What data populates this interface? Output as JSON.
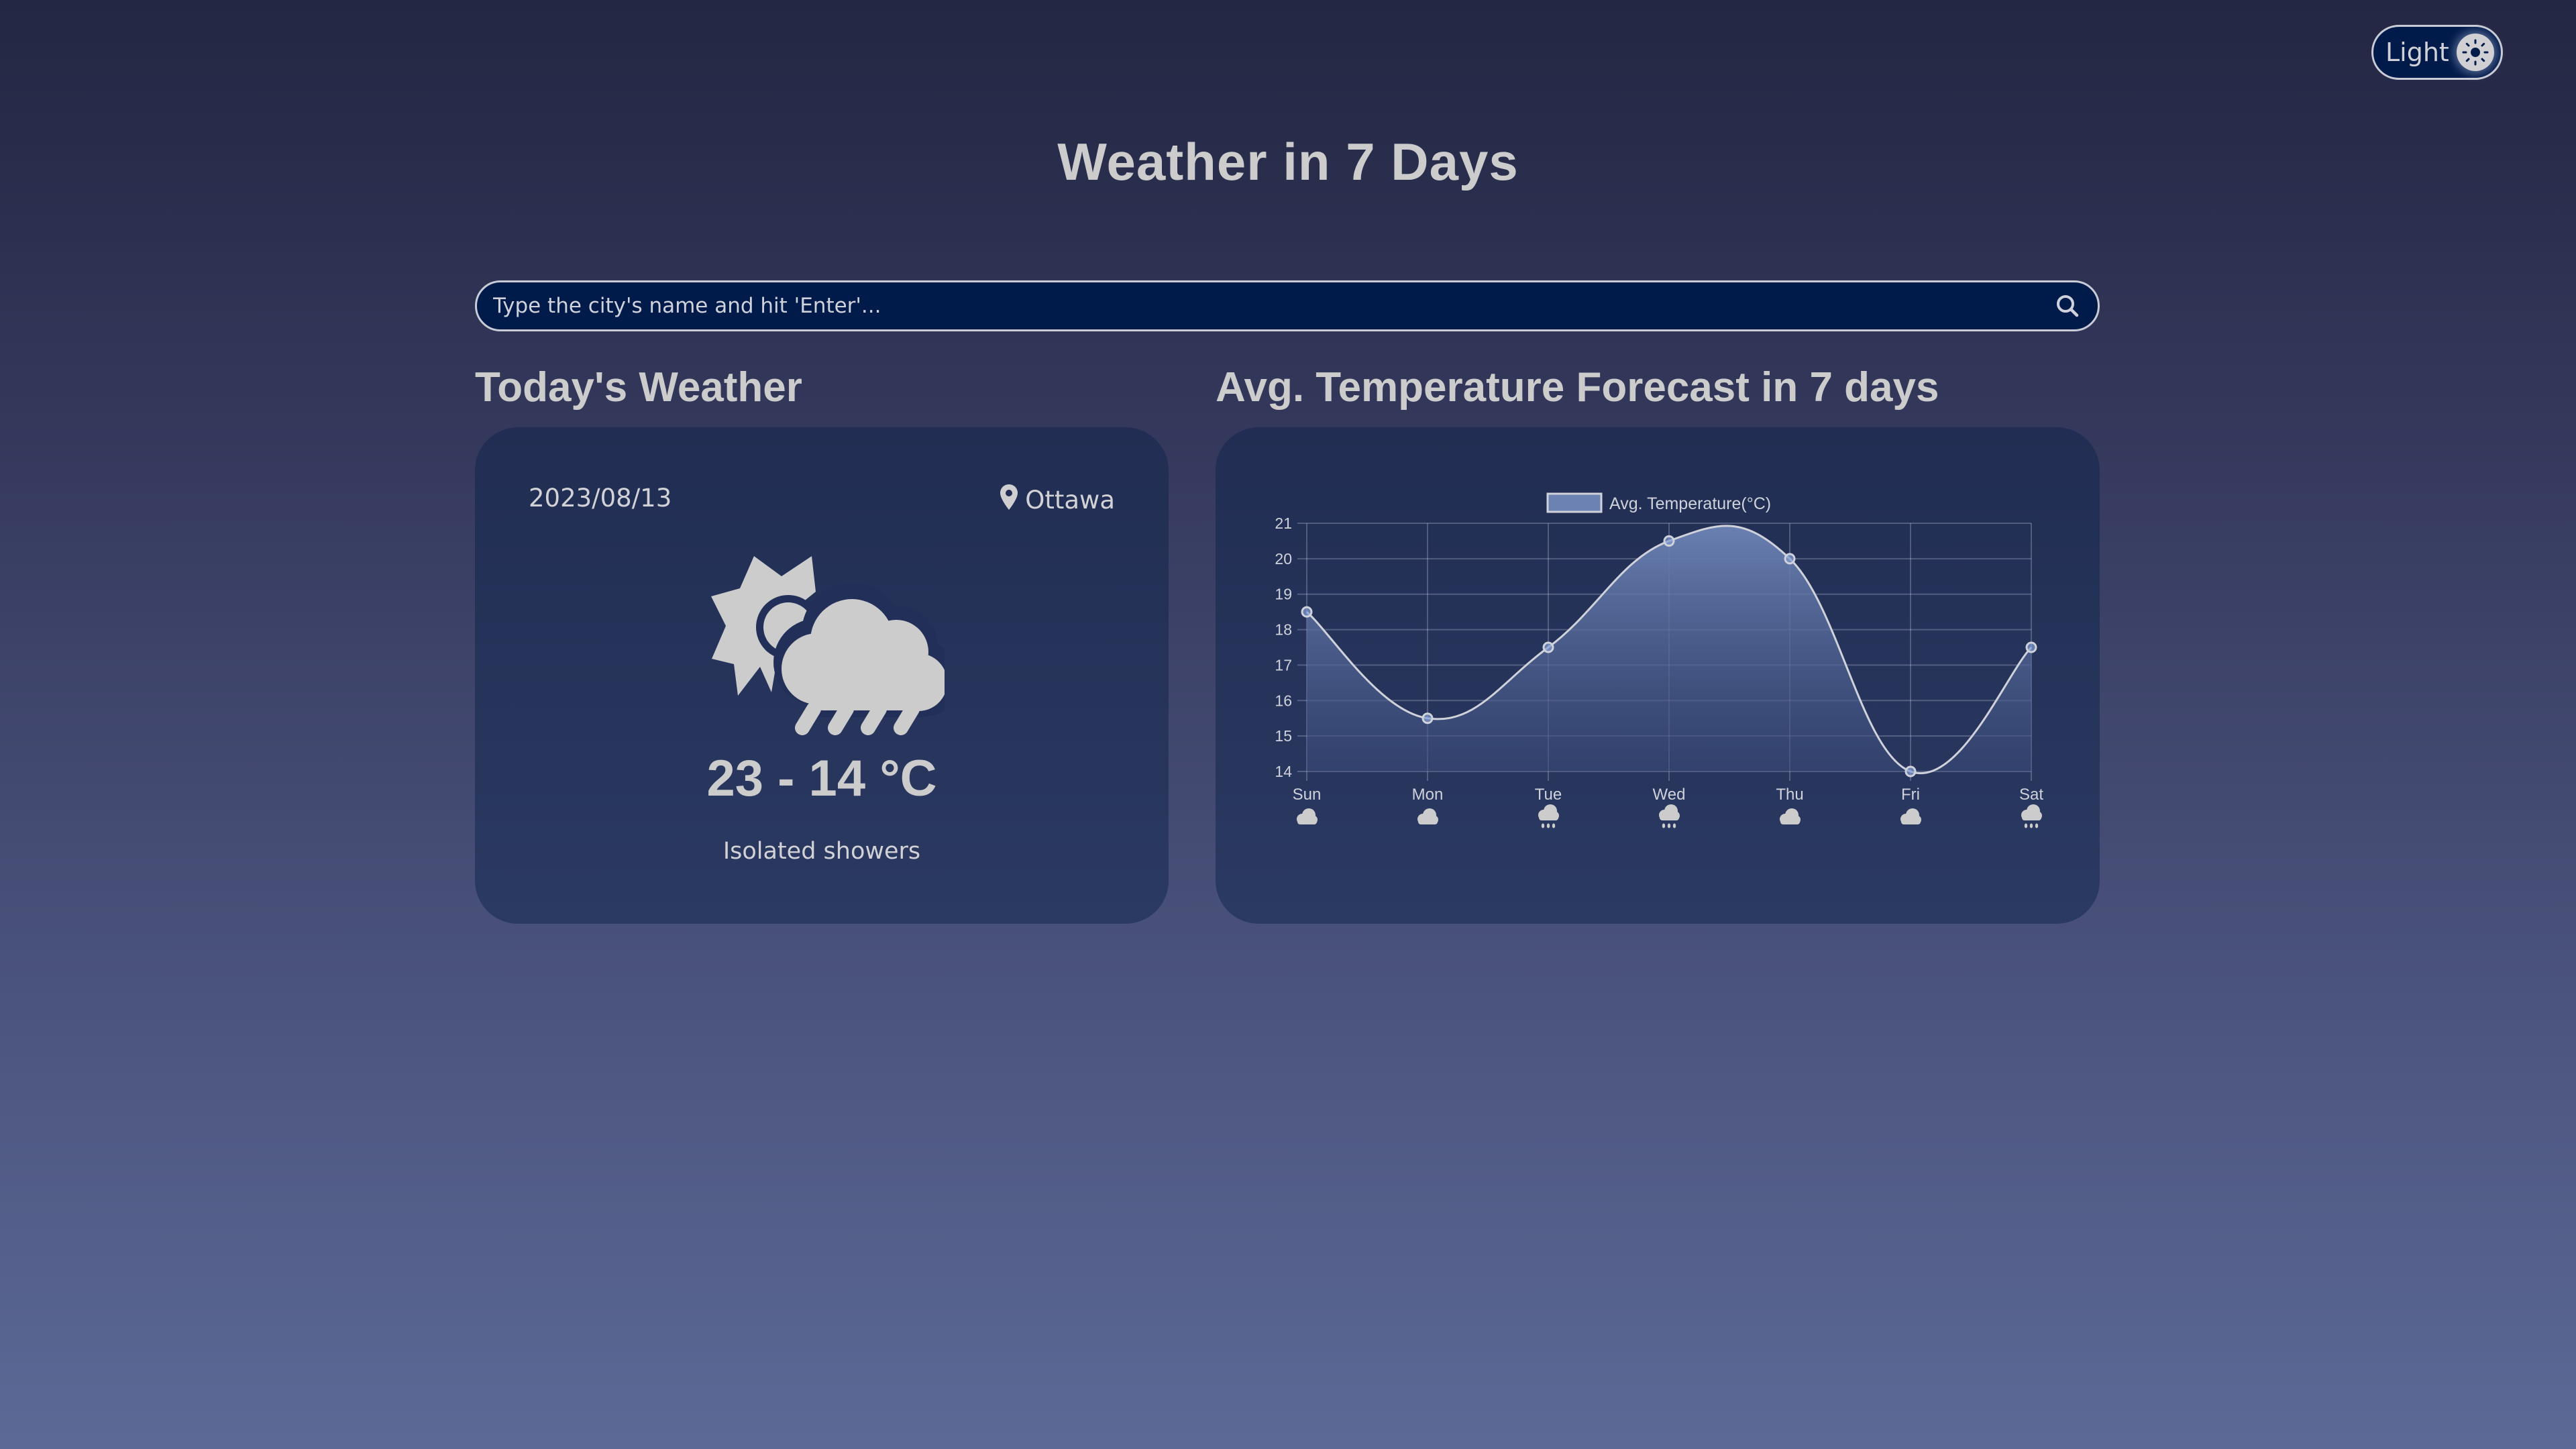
{
  "theme_toggle": {
    "label": "Light",
    "icon": "sun-icon"
  },
  "header": {
    "title": "Weather in 7 Days"
  },
  "search": {
    "placeholder": "Type the city's name and hit 'Enter'...",
    "value": "",
    "icon": "search-icon"
  },
  "today": {
    "heading": "Today's Weather",
    "date": "2023/08/13",
    "city": "Ottawa",
    "location_icon": "map-pin-icon",
    "condition_icon": "sun-cloud-rain-icon",
    "temperature": "23 - 14 °C",
    "description": "Isolated showers"
  },
  "forecast": {
    "heading": "Avg. Temperature Forecast in 7 days"
  },
  "colors": {
    "accent_fill": "#6b82b3",
    "line": "#cfd2da",
    "card_bg": "#24305a",
    "input_bg": "#001a4a"
  },
  "chart_data": {
    "type": "area",
    "title": "",
    "legend": [
      "Avg. Temperature(°C)"
    ],
    "legend_position": "top",
    "categories": [
      "Sun",
      "Mon",
      "Tue",
      "Wed",
      "Thu",
      "Fri",
      "Sat"
    ],
    "category_icons": [
      "cloud-icon",
      "cloud-icon",
      "cloud-rain-icon",
      "cloud-rain-icon",
      "cloud-icon",
      "cloud-icon",
      "cloud-rain-icon"
    ],
    "series": [
      {
        "name": "Avg. Temperature(°C)",
        "values": [
          18.5,
          15.5,
          17.5,
          20.5,
          20,
          14,
          17.5
        ]
      }
    ],
    "xlabel": "",
    "ylabel": "",
    "ylim": [
      14,
      21
    ],
    "yticks": [
      14,
      15,
      16,
      17,
      18,
      19,
      20,
      21
    ],
    "grid": true,
    "smooth": true
  }
}
